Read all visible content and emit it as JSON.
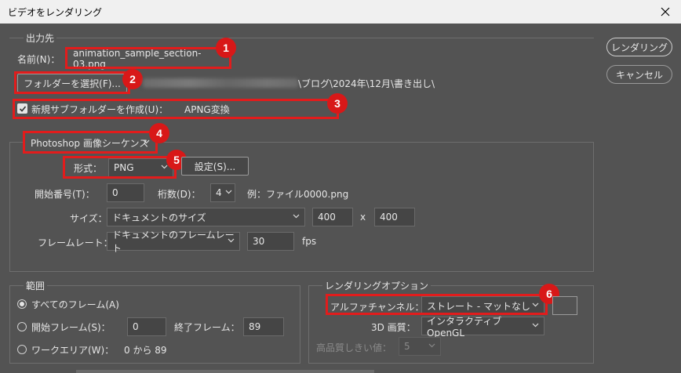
{
  "window": {
    "title": "ビデオをレンダリング"
  },
  "output": {
    "legend": "出力先",
    "name_label": "名前(N)：",
    "name_value": "animation_sample_section-03.png",
    "folder_button": "フォルダーを選択(F)...",
    "folder_path_suffix": "\\ブログ\\2024年\\12月\\書き出し\\",
    "subfolder_label": "新規サブフォルダーを作成(U)：",
    "subfolder_value": "APNG変換"
  },
  "sequence": {
    "type_select": "Photoshop 画像シーケンス",
    "format_label": "形式：",
    "format_value": "PNG",
    "settings_button": "設定(S)...",
    "start_number_label": "開始番号(T)：",
    "start_number_value": "0",
    "digits_label": "桁数(D)：",
    "digits_value": "4",
    "example_label": "例：ファイル0000.png",
    "size_label": "サイズ：",
    "size_select": "ドキュメントのサイズ",
    "width_value": "400",
    "size_x": "x",
    "height_value": "400",
    "framerate_label": "フレームレート：",
    "framerate_select": "ドキュメントのフレームレート",
    "framerate_value": "30",
    "fps_label": "fps"
  },
  "range": {
    "legend": "範囲",
    "all_frames": "すべてのフレーム(A)",
    "start_frame_label": "開始フレーム(S)：",
    "start_frame_value": "0",
    "end_frame_label": "終了フレーム：",
    "end_frame_value": "89",
    "work_area_label": "ワークエリア(W)：",
    "work_area_value": "0 から 89"
  },
  "render_options": {
    "legend": "レンダリングオプション",
    "alpha_label": "アルファチャンネル：",
    "alpha_value": "ストレート - マットなし",
    "d3_label": "3D 画質：",
    "d3_value": "インタラクティブ OpenGL",
    "hq_label": "高品質しきい値：",
    "hq_value": "5"
  },
  "buttons": {
    "render": "レンダリング",
    "cancel": "キャンセル"
  },
  "badges": [
    "1",
    "2",
    "3",
    "4",
    "5",
    "6"
  ],
  "colors": {
    "highlight": "#e21c1c",
    "badge": "#d81818",
    "background": "#535353"
  }
}
